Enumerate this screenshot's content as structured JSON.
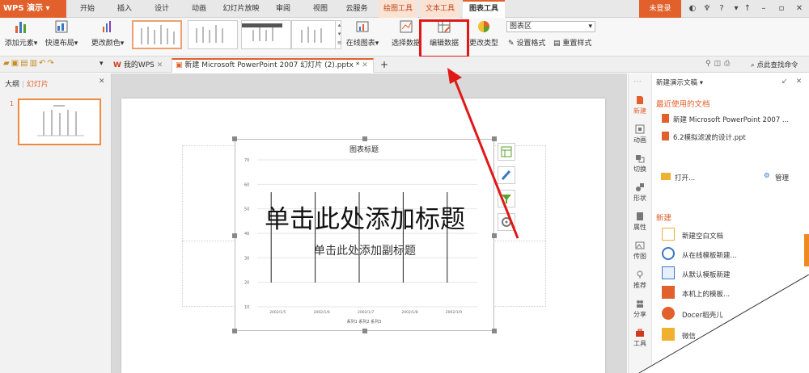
{
  "app": {
    "logo": "WPS 演示",
    "login": "未登录",
    "help": "?"
  },
  "menu": {
    "items": [
      "开始",
      "插入",
      "设计",
      "动画",
      "幻灯片放映",
      "审阅",
      "视图",
      "云服务",
      "绘图工具",
      "文本工具",
      "图表工具"
    ]
  },
  "ribbon": {
    "add_element": "添加元素",
    "quick_layout": "快速布局",
    "change_color": "更改颜色",
    "online_chart": "在线图表",
    "select_data": "选择数据",
    "edit_data": "编辑数据",
    "change_type": "更改类型",
    "chart_area": "图表区",
    "set_format": "设置格式",
    "reset_style": "重置样式"
  },
  "tabs": {
    "home": "我的WPS",
    "doc": "新建 Microsoft PowerPoint 2007 幻灯片 (2).pptx *",
    "add": "+",
    "search": "点此查找命令"
  },
  "left": {
    "outline": "大纲",
    "slides": "幻灯片",
    "slide_num": "1"
  },
  "slide": {
    "chart_title": "图表标题",
    "title_placeholder": "单击此处添加标题",
    "subtitle_placeholder": "单击此处添加副标题",
    "legend": "系列1  系列2  系列3"
  },
  "chart_data": {
    "type": "bar",
    "categories": [
      "2002/1/5",
      "2002/1/6",
      "2002/1/7",
      "2002/1/8",
      "2002/1/9"
    ],
    "y_ticks": [
      "70",
      "60",
      "50",
      "40",
      "30",
      "20",
      "10"
    ],
    "ylim": [
      10,
      70
    ],
    "title": "图表标题"
  },
  "sidebar": {
    "items": [
      "新建",
      "动画",
      "切换",
      "形状",
      "属性",
      "传图",
      "推荐",
      "分享",
      "工具"
    ]
  },
  "rpanel": {
    "header": "新建演示文稿",
    "recent_title": "最近使用的文档",
    "recent": [
      "新建 Microsoft PowerPoint 2007 ...",
      "6.2模拟滤波的设计.ppt"
    ],
    "open": "打开...",
    "manage": "管理",
    "new_title": "新建",
    "new_items": [
      "新建空白文档",
      "从在线模板新建...",
      "从默认模板新建",
      "本机上的模板...",
      "Docer稻壳儿",
      "微信"
    ]
  },
  "colors": {
    "accent": "#e1602b",
    "highlight": "#e01818"
  }
}
